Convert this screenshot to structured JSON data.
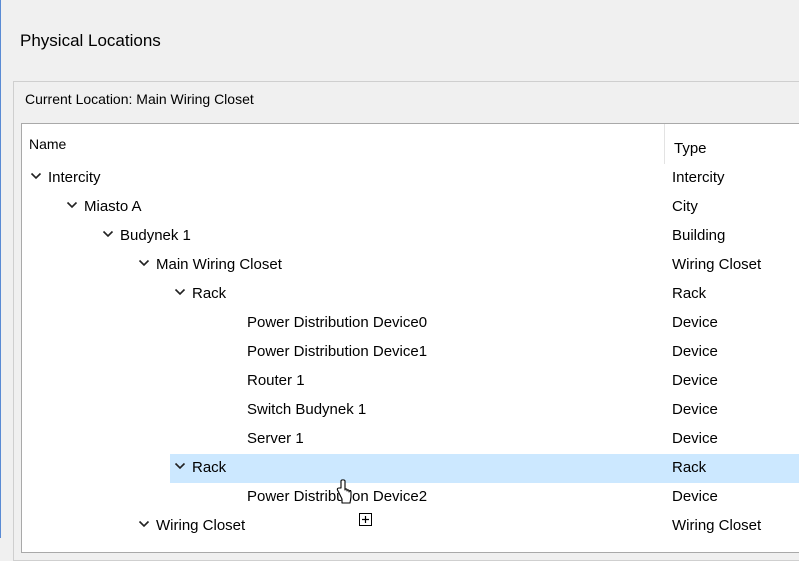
{
  "dialog": {
    "title": "Physical Locations"
  },
  "location": {
    "current": "Current Location: Main Wiring Closet"
  },
  "tree": {
    "columns": {
      "name": "Name",
      "type": "Type"
    },
    "rows": [
      {
        "label": "Intercity",
        "type": "Intercity",
        "level": 0,
        "expandable": true,
        "selected": false
      },
      {
        "label": "Miasto A",
        "type": "City",
        "level": 1,
        "expandable": true,
        "selected": false
      },
      {
        "label": "Budynek 1",
        "type": "Building",
        "level": 2,
        "expandable": true,
        "selected": false
      },
      {
        "label": "Main Wiring Closet",
        "type": "Wiring Closet",
        "level": 3,
        "expandable": true,
        "selected": false
      },
      {
        "label": "Rack",
        "type": "Rack",
        "level": 4,
        "expandable": true,
        "selected": false
      },
      {
        "label": "Power Distribution Device0",
        "type": "Device",
        "level": 5,
        "expandable": false,
        "selected": false
      },
      {
        "label": "Power Distribution Device1",
        "type": "Device",
        "level": 5,
        "expandable": false,
        "selected": false
      },
      {
        "label": "Router 1",
        "type": "Device",
        "level": 5,
        "expandable": false,
        "selected": false
      },
      {
        "label": "Switch Budynek 1",
        "type": "Device",
        "level": 5,
        "expandable": false,
        "selected": false
      },
      {
        "label": "Server 1",
        "type": "Device",
        "level": 5,
        "expandable": false,
        "selected": false
      },
      {
        "label": "Rack",
        "type": "Rack",
        "level": 4,
        "expandable": true,
        "selected": true
      },
      {
        "label": "Power Distribution Device2",
        "type": "Device",
        "level": 5,
        "expandable": false,
        "selected": false
      },
      {
        "label": "Wiring Closet",
        "type": "Wiring Closet",
        "level": 3,
        "expandable": true,
        "selected": false
      }
    ]
  },
  "colors": {
    "selection": "#cce8ff",
    "window_accent": "#5a8bd4"
  },
  "icons": {
    "expanded": "chevron-down-icon",
    "pointer": "mouse-cursor-icon",
    "drag": "drag-add-icon"
  }
}
